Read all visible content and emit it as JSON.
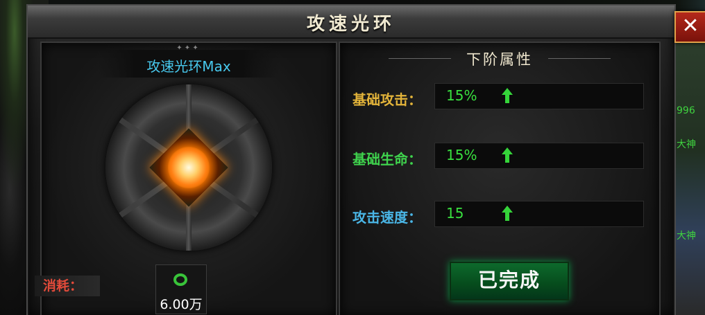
{
  "window": {
    "title": "攻速光环",
    "close_label": "✕"
  },
  "left_panel": {
    "item_name": "攻速光环Max",
    "cost_label": "消耗：",
    "cost_value": "6.00万",
    "cost_icon": "green-ring-icon"
  },
  "right_panel": {
    "title": "下阶属性",
    "rows": [
      {
        "label": "基础攻击：",
        "value": "15%",
        "label_color": "#e3b43a"
      },
      {
        "label": "基础生命：",
        "value": "15%",
        "label_color": "#3fd24d"
      },
      {
        "label": "攻击速度：",
        "value": "15",
        "label_color": "#4ab6e6"
      }
    ],
    "done_button": "已完成"
  },
  "side": {
    "text1": "996",
    "text2": "大神",
    "text3": "大神"
  },
  "colors": {
    "accent_green": "#39e03f",
    "name_blue": "#48c9ee",
    "close_red": "#b4291b"
  }
}
